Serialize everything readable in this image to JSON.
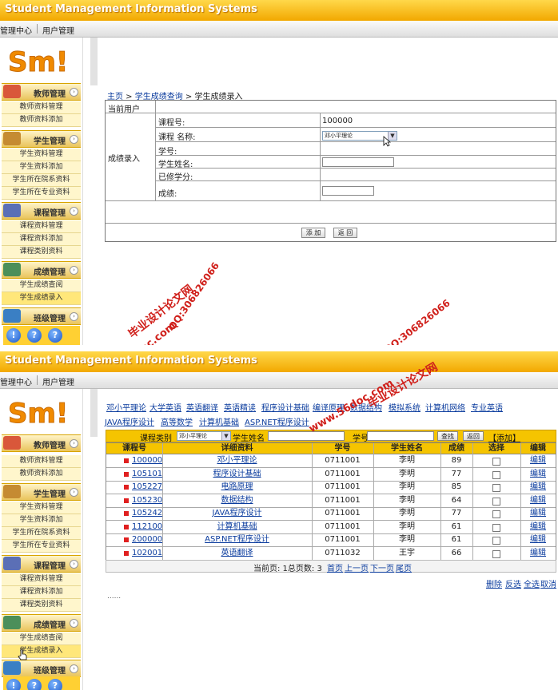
{
  "app_title": "Student Management Information Systems",
  "top_menu": [
    "管理中心",
    "用户管理"
  ],
  "logo_text": "Sm!",
  "sidebar": {
    "groups": [
      {
        "title": "教师管理",
        "items": [
          "教师资料管理",
          "教师资料添加"
        ]
      },
      {
        "title": "学生管理",
        "items": [
          "学生资料管理",
          "学生资料添加",
          "学生所在院系资料",
          "学生所在专业资料"
        ]
      },
      {
        "title": "课程管理",
        "items": [
          "课程资料管理",
          "课程资料添加",
          "课程类别资料"
        ]
      },
      {
        "title": "成绩管理",
        "items": [
          "学生成绩查阅",
          "学生成绩录入"
        ]
      },
      {
        "title": "班级管理",
        "items": []
      }
    ],
    "bottom_icons": [
      "!",
      "?",
      "?"
    ]
  },
  "screen1": {
    "breadcrumb": {
      "home": "主页",
      "sep": " > ",
      "query": "学生成绩查询",
      "current": "学生成绩录入"
    },
    "current_user_label": "当前用户",
    "section_label": "成绩录入",
    "fields": {
      "course_no_label": "课程号:",
      "course_no_value": "100000",
      "course_name_label": "课程 名称:",
      "course_name_selected": "邓小平理论",
      "student_no_label": "学号:",
      "student_name_label": "学生姓名:",
      "credits_label": "已修学分:",
      "score_label": "成绩:"
    },
    "buttons": {
      "add": "添 加",
      "back": "返 回"
    }
  },
  "screen2": {
    "course_tabs": [
      "邓小平理论",
      "大学英语",
      "英语翻译",
      "英语精读",
      "程序设计基础",
      "编译原理",
      "数据结构",
      "模拟系统",
      "计算机网络",
      "专业英语",
      "JAVA程序设计",
      "高等数学",
      "计算机基础",
      "ASP.NET程序设计"
    ],
    "filter": {
      "category_label": "课程类别",
      "category_value": "邓小平理论",
      "student_name_label": "学生姓名",
      "student_no_label": "学号",
      "search_button": "查找",
      "back_button": "返回",
      "add_link": "【添加】"
    },
    "table": {
      "headers": [
        "课程号",
        "详细资料",
        "学号",
        "学生姓名",
        "成绩",
        "选择",
        "编辑"
      ],
      "rows": [
        [
          "100000",
          "邓小平理论",
          "0711001",
          "李明",
          "89",
          "",
          "编辑"
        ],
        [
          "105101",
          "程序设计基础",
          "0711001",
          "李明",
          "77",
          "",
          "编辑"
        ],
        [
          "105227",
          "电路原理",
          "0711001",
          "李明",
          "85",
          "",
          "编辑"
        ],
        [
          "105230",
          "数据结构",
          "0711001",
          "李明",
          "64",
          "",
          "编辑"
        ],
        [
          "105242",
          "JAVA程序设计",
          "0711001",
          "李明",
          "77",
          "",
          "编辑"
        ],
        [
          "112100",
          "计算机基础",
          "0711001",
          "李明",
          "61",
          "",
          "编辑"
        ],
        [
          "200000",
          "ASP.NET程序设计",
          "0711001",
          "李明",
          "61",
          "",
          "编辑"
        ],
        [
          "102001",
          "英语翻译",
          "0711032",
          "王宇",
          "66",
          "",
          "编辑"
        ]
      ]
    },
    "pager": {
      "text": "当前页: 1总页数: 3",
      "first": "首页",
      "prev": "上一页",
      "next": "下一页",
      "last": "尾页"
    },
    "bottom_actions": [
      "删除",
      "反选",
      "全选",
      "取消"
    ],
    "ellipsis": "......"
  },
  "watermarks": [
    "毕业设计论文网",
    "www.56doc.com",
    "QQ:306826066"
  ],
  "colors": {
    "banner": "#f2a800",
    "sidebar_group": "#e9c45c",
    "table_header": "#f5c400",
    "link": "#0b3c9e",
    "watermark": "#d0201b"
  }
}
